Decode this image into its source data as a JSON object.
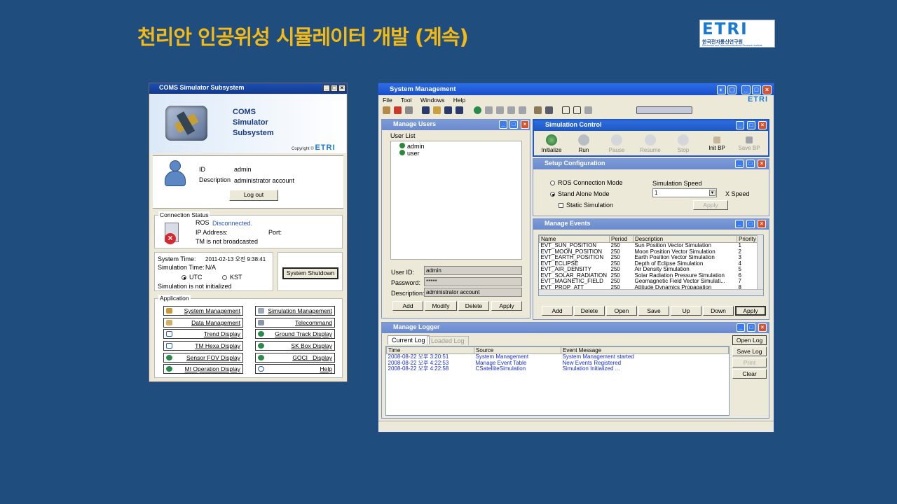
{
  "slide": {
    "title": "천리안 인공위성 시뮬레이터 개발 (계속)",
    "logo_text": "ETRI",
    "logo_korean": "한국전자통신연구원",
    "logo_english": "Electronics and Telecommunications Research Institute"
  },
  "win1": {
    "title": "COMS Simulator Subsystem",
    "banner": {
      "line1": "COMS",
      "line2": "Simulator",
      "line3": "Subsystem",
      "copyright": "Copyright ©",
      "brand": "ETRI"
    },
    "user": {
      "id_label": "ID",
      "id_value": "admin",
      "desc_label": "Description",
      "desc_value": "administrator account",
      "logout": "Log out"
    },
    "connection": {
      "legend": "Connection Status",
      "ros_label": "ROS",
      "ros_status": "Disconnected.",
      "ip_label": "IP Address:",
      "port_label": "Port:",
      "tm": "TM is not broadcasted"
    },
    "system": {
      "time_label": "System Time:",
      "time_value": "2011-02-13 오전 9:38:41",
      "sim_time_label": "Simulation Time:",
      "sim_time_value": "N/A",
      "utc": "UTC",
      "kst": "KST",
      "status": "Simulation is not initialized",
      "shutdown": "System Shutdown"
    },
    "application": {
      "legend": "Application",
      "left": [
        "System Management",
        "Data Management",
        "Trend Display",
        "TM Hexa Display",
        "Sensor FOV Display",
        "MI Operation Display"
      ],
      "right": [
        "Simulation Management",
        "Telecommand",
        "Ground Track Display",
        "SK Box Display",
        "GOCI   Display",
        "Help"
      ]
    }
  },
  "win2": {
    "title": "System Management",
    "menu": [
      "File",
      "Tool",
      "Windows",
      "Help"
    ],
    "brand": "ETRI",
    "manage_users": {
      "title": "Manage Users",
      "list_label": "User List",
      "users": [
        "admin",
        "user"
      ],
      "userid_label": "User ID:",
      "userid_value": "admin",
      "password_label": "Password:",
      "password_value": "*****",
      "desc_label": "Description:",
      "desc_value": "administrator account",
      "buttons": [
        "Add",
        "Modify",
        "Delete",
        "Apply"
      ]
    },
    "sim_control": {
      "title": "Simulation Control",
      "buttons": [
        "Initialize",
        "Run",
        "Pause",
        "Resume",
        "Stop",
        "Init BP",
        "Save BP"
      ]
    },
    "setup": {
      "title": "Setup Configuration",
      "ros_mode": "ROS Connection Mode",
      "standalone": "Stand Alone Mode",
      "static": "Static Simulation",
      "speed_label": "Simulation Speed",
      "speed_value": "1",
      "speed_unit": "X Speed",
      "apply": "Apply"
    },
    "events": {
      "title": "Manage Events",
      "columns": [
        "Name",
        "Period",
        "Description",
        "Priority"
      ],
      "rows": [
        [
          "EVT_SUN_POSITION",
          "250",
          "Sun Position Vector Simulation",
          "1"
        ],
        [
          "EVT_MOON_POSITION",
          "250",
          "Moon Position Vector Simulation",
          "2"
        ],
        [
          "EVT_EARTH_POSITION",
          "250",
          "Earth Position Vector Simulation",
          "3"
        ],
        [
          "EVT_ECLIPSE",
          "250",
          "Depth of Eclipse Simulation",
          "4"
        ],
        [
          "EVT_AIR_DENSITY",
          "250",
          "Air Density Simulation",
          "5"
        ],
        [
          "EVT_SOLAR_RADIATION",
          "250",
          "Solar Radiation Pressure Simulation",
          "6"
        ],
        [
          "EVT_MAGNETIC_FIELD",
          "250",
          "Geomagnetic Field Vector Simulati...",
          "7"
        ],
        [
          "EVT_PROP_ATT",
          "250",
          "Attitude Dynamics Propagation",
          "8"
        ]
      ],
      "buttons": [
        "Add",
        "Delete",
        "Open",
        "Save",
        "Up",
        "Down",
        "Apply"
      ]
    },
    "logger": {
      "title": "Manage Logger",
      "tabs": [
        "Current Log",
        "Loaded Log"
      ],
      "columns": [
        "Time",
        "Source",
        "Event Message"
      ],
      "rows": [
        [
          "2008-08-22 오후 3:20:51",
          "System Management",
          "System Management started"
        ],
        [
          "2008-08-22 오후 4:22:53",
          "Manage Event Table",
          "New Events Registered"
        ],
        [
          "2008-08-22 오후 4:22:58",
          "CSatelliteSimulation",
          "Simulation Initialized ..."
        ]
      ],
      "buttons": [
        "Open Log",
        "Save Log",
        "Print",
        "Clear"
      ]
    }
  }
}
